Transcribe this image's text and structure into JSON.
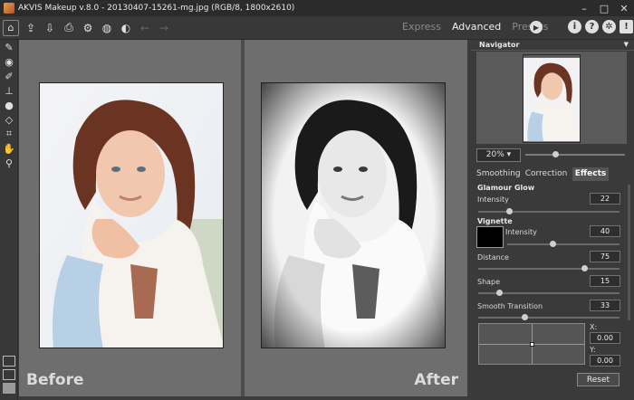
{
  "window": {
    "title": "AKVIS Makeup v.8.0 - 20130407-15261-mg.jpg (RGB/8, 1800x2610)"
  },
  "modes": {
    "express": "Express",
    "advanced": "Advanced",
    "presets": "Presets"
  },
  "canvas": {
    "before_label": "Before",
    "after_label": "After"
  },
  "navigator": {
    "title": "Navigator",
    "zoom": "20%",
    "zoom_level": 0.3
  },
  "tabs": {
    "smoothing": "Smoothing",
    "correction": "Correction",
    "effects": "Effects",
    "active": "effects"
  },
  "glamour_glow": {
    "title": "Glamour Glow",
    "intensity_label": "Intensity",
    "intensity": "22"
  },
  "vignette": {
    "title": "Vignette",
    "color": "#000000",
    "intensity_label": "Intensity",
    "intensity": "40",
    "distance_label": "Distance",
    "distance": "75",
    "shape_label": "Shape",
    "shape": "15",
    "smooth_label": "Smooth Transition",
    "smooth": "33",
    "x_label": "X:",
    "x": "0.00",
    "y_label": "Y:",
    "y": "0.00"
  },
  "buttons": {
    "reset": "Reset"
  },
  "icons": {
    "toolbar": [
      "home-icon",
      "open-icon",
      "save-icon",
      "print-icon",
      "batch-icon",
      "share-icon",
      "presets-icon",
      "undo-icon",
      "redo-icon"
    ],
    "right": [
      "info-icon",
      "help-icon",
      "settings-icon",
      "notification-icon"
    ],
    "tools": [
      "brush-icon",
      "eye-icon",
      "pencil-icon",
      "stamp-icon",
      "drop-icon",
      "eraser-icon",
      "crop-icon",
      "hand-icon",
      "zoom-icon"
    ]
  }
}
